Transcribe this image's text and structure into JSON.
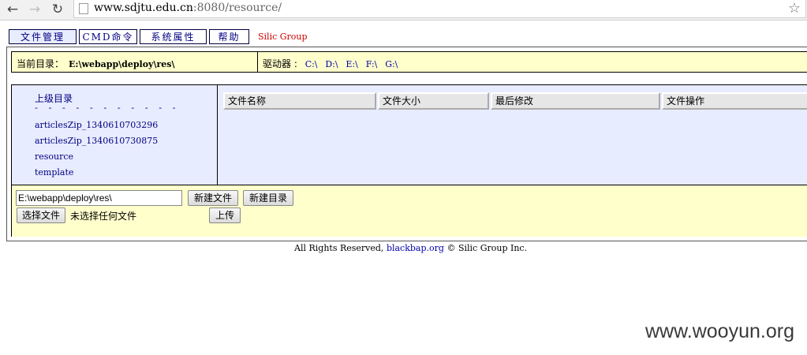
{
  "browser": {
    "url_host": "www.sdjtu.edu.cn",
    "url_rest": ":8080/resource/"
  },
  "menu": {
    "items": [
      "文件管理",
      "CMD命令",
      "系统属性",
      "帮助"
    ],
    "brand": "Silic Group"
  },
  "dirbar": {
    "current_label": "当前目录：",
    "current_path": "E:\\webapp\\deploy\\res\\",
    "drives_label": "驱动器 :",
    "drives": [
      "C:\\",
      "D:\\",
      "E:\\",
      "F:\\",
      "G:\\"
    ]
  },
  "tree": {
    "parent": "上级目录",
    "dashes": "- - - - - - - - - - -",
    "items": [
      "articlesZip_1340610703296",
      "articlesZip_1340610730875",
      "resource",
      "template"
    ]
  },
  "table": {
    "columns": [
      "文件名称",
      "文件大小",
      "最后修改",
      "文件操作"
    ]
  },
  "toolbar": {
    "path_value": "E:\\webapp\\deploy\\res\\",
    "new_file": "新建文件",
    "new_dir": "新建目录",
    "choose_file": "选择文件",
    "no_file": "未选择任何文件",
    "upload": "上传"
  },
  "footer": {
    "prefix": "All Rights Reserved,",
    "link": "blackbap.org",
    "suffix": "© Silic Group Inc."
  },
  "watermark": "www.wooyun.org"
}
